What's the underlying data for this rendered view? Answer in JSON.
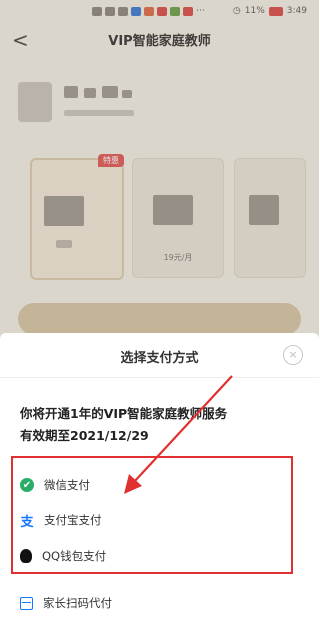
{
  "status_bar": {
    "left_text": "⋯",
    "battery": "11%",
    "time": "3:49"
  },
  "nav": {
    "back_label": "<",
    "title": "VIP智能家庭教师"
  },
  "plans": [
    {
      "badge": "特惠",
      "price_sub": ""
    },
    {
      "badge": "",
      "price_sub": "19元/月"
    },
    {
      "badge": "",
      "price_sub": ""
    }
  ],
  "sheet": {
    "title": "选择支付方式",
    "close_label": "×",
    "service_line1": "你将开通1年的VIP智能家庭教师服务",
    "service_line2": "有效期至2021/12/29",
    "payment_methods": [
      {
        "label": "微信支付",
        "icon": "wechat-icon",
        "color": "#2aae67"
      },
      {
        "label": "支付宝支付",
        "icon": "alipay-icon",
        "color": "#1677ff"
      },
      {
        "label": "QQ钱包支付",
        "icon": "qq-icon",
        "color": "#111111"
      }
    ],
    "scan_label": "家长扫码代付"
  },
  "colors": {
    "annotation_red": "#e03030",
    "accent_gold": "#c9b48b"
  }
}
